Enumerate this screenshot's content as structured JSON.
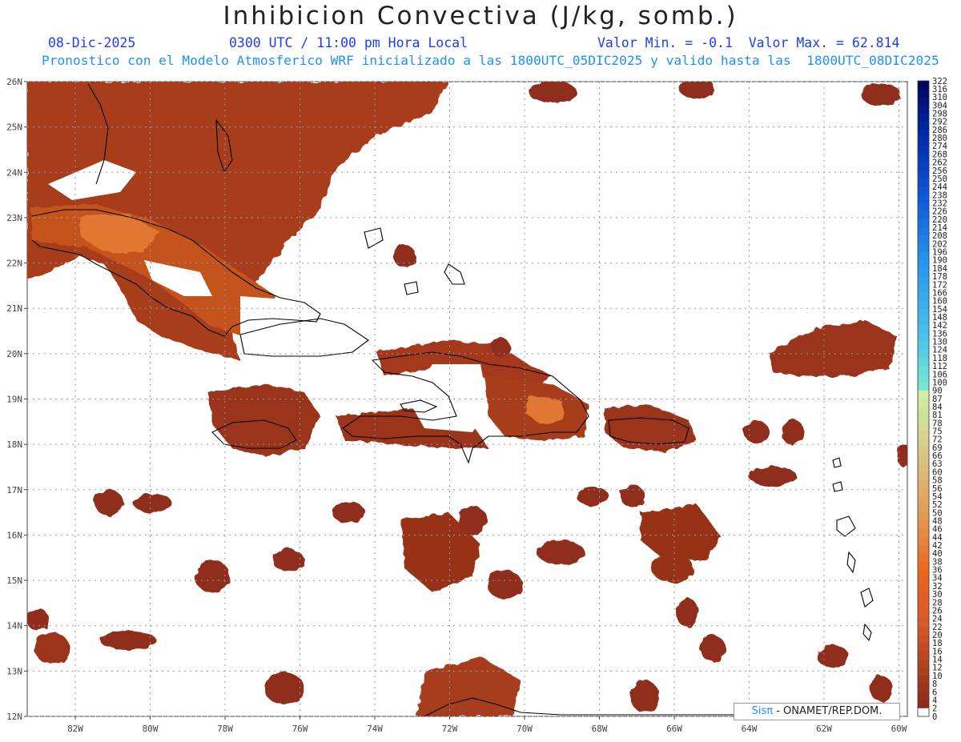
{
  "title": "Inhibicion Convectiva (J/kg, somb.)",
  "date": "08-Dic-2025",
  "time": "0300 UTC / 11:00 pm Hora Local",
  "min_max": "Valor Min. = -0.1  Valor Max. = 62.814",
  "model_info": "Pronostico con el Modelo Atmosferico WRF inicializado a las 1800UTC_05DIC2025 y valido hasta las  1800UTC_08DIC2025",
  "credit": {
    "brand": "Sisπ",
    "rest": " - ONAMET/REP.DOM."
  },
  "colors": {
    "fill_low": "#8b2b1c",
    "fill_mid": "#b5441f",
    "fill_high": "#e06a28",
    "coast": "#000000",
    "grid": "#9a9a9a"
  },
  "map": {
    "lat_labels": [
      "26N",
      "25N",
      "24N",
      "23N",
      "22N",
      "21N",
      "20N",
      "19N",
      "18N",
      "17N",
      "16N",
      "15N",
      "14N",
      "13N",
      "12N"
    ],
    "lon_labels": [
      "82W",
      "80W",
      "78W",
      "76W",
      "74W",
      "72W",
      "70W",
      "68W",
      "66W",
      "64W",
      "62W",
      "60W"
    ]
  },
  "colorbar": {
    "labels": [
      "322",
      "316",
      "310",
      "304",
      "298",
      "292",
      "286",
      "280",
      "274",
      "268",
      "262",
      "256",
      "250",
      "244",
      "238",
      "232",
      "226",
      "220",
      "214",
      "208",
      "202",
      "196",
      "190",
      "184",
      "178",
      "172",
      "166",
      "160",
      "154",
      "148",
      "142",
      "136",
      "130",
      "124",
      "118",
      "112",
      "106",
      "100",
      "90",
      "87",
      "84",
      "81",
      "78",
      "75",
      "72",
      "69",
      "66",
      "63",
      "60",
      "58",
      "56",
      "54",
      "52",
      "50",
      "48",
      "46",
      "44",
      "42",
      "40",
      "38",
      "36",
      "34",
      "32",
      "30",
      "28",
      "26",
      "24",
      "22",
      "20",
      "18",
      "16",
      "14",
      "12",
      "10",
      "8",
      "6",
      "4",
      "2",
      "0"
    ]
  }
}
